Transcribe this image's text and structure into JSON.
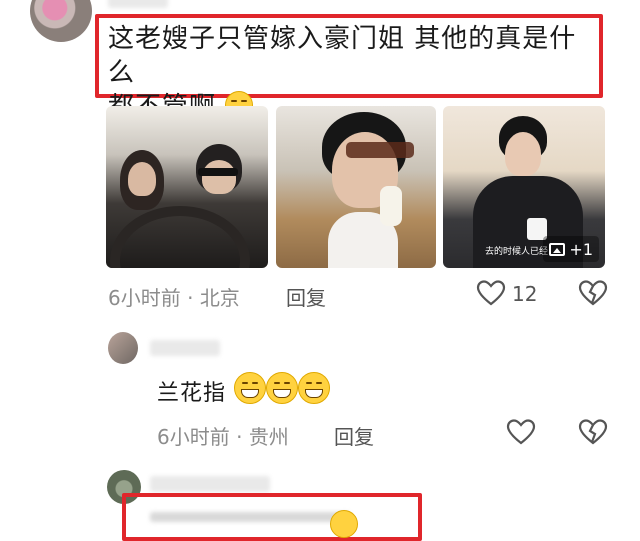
{
  "comments": [
    {
      "text_line1": "这老嫂子只管嫁入豪门姐 其他的真是什么",
      "text_line2": "都不管啊",
      "emoji": "smirk-face",
      "time": "6小时前",
      "location": "北京",
      "reply_label": "回复",
      "like_count": "12",
      "photo_more_label": "+1",
      "photo_caption": "去的时候人已经"
    },
    {
      "text": "兰花指",
      "emoji": "grinning-face",
      "emoji_count": 3,
      "time": "6小时前",
      "location": "贵州",
      "reply_label": "回复"
    }
  ],
  "separator": "·",
  "colors": {
    "highlight_border": "#e0262b",
    "meta_text": "#8c8c8c",
    "body_text": "#1a1a1a"
  }
}
